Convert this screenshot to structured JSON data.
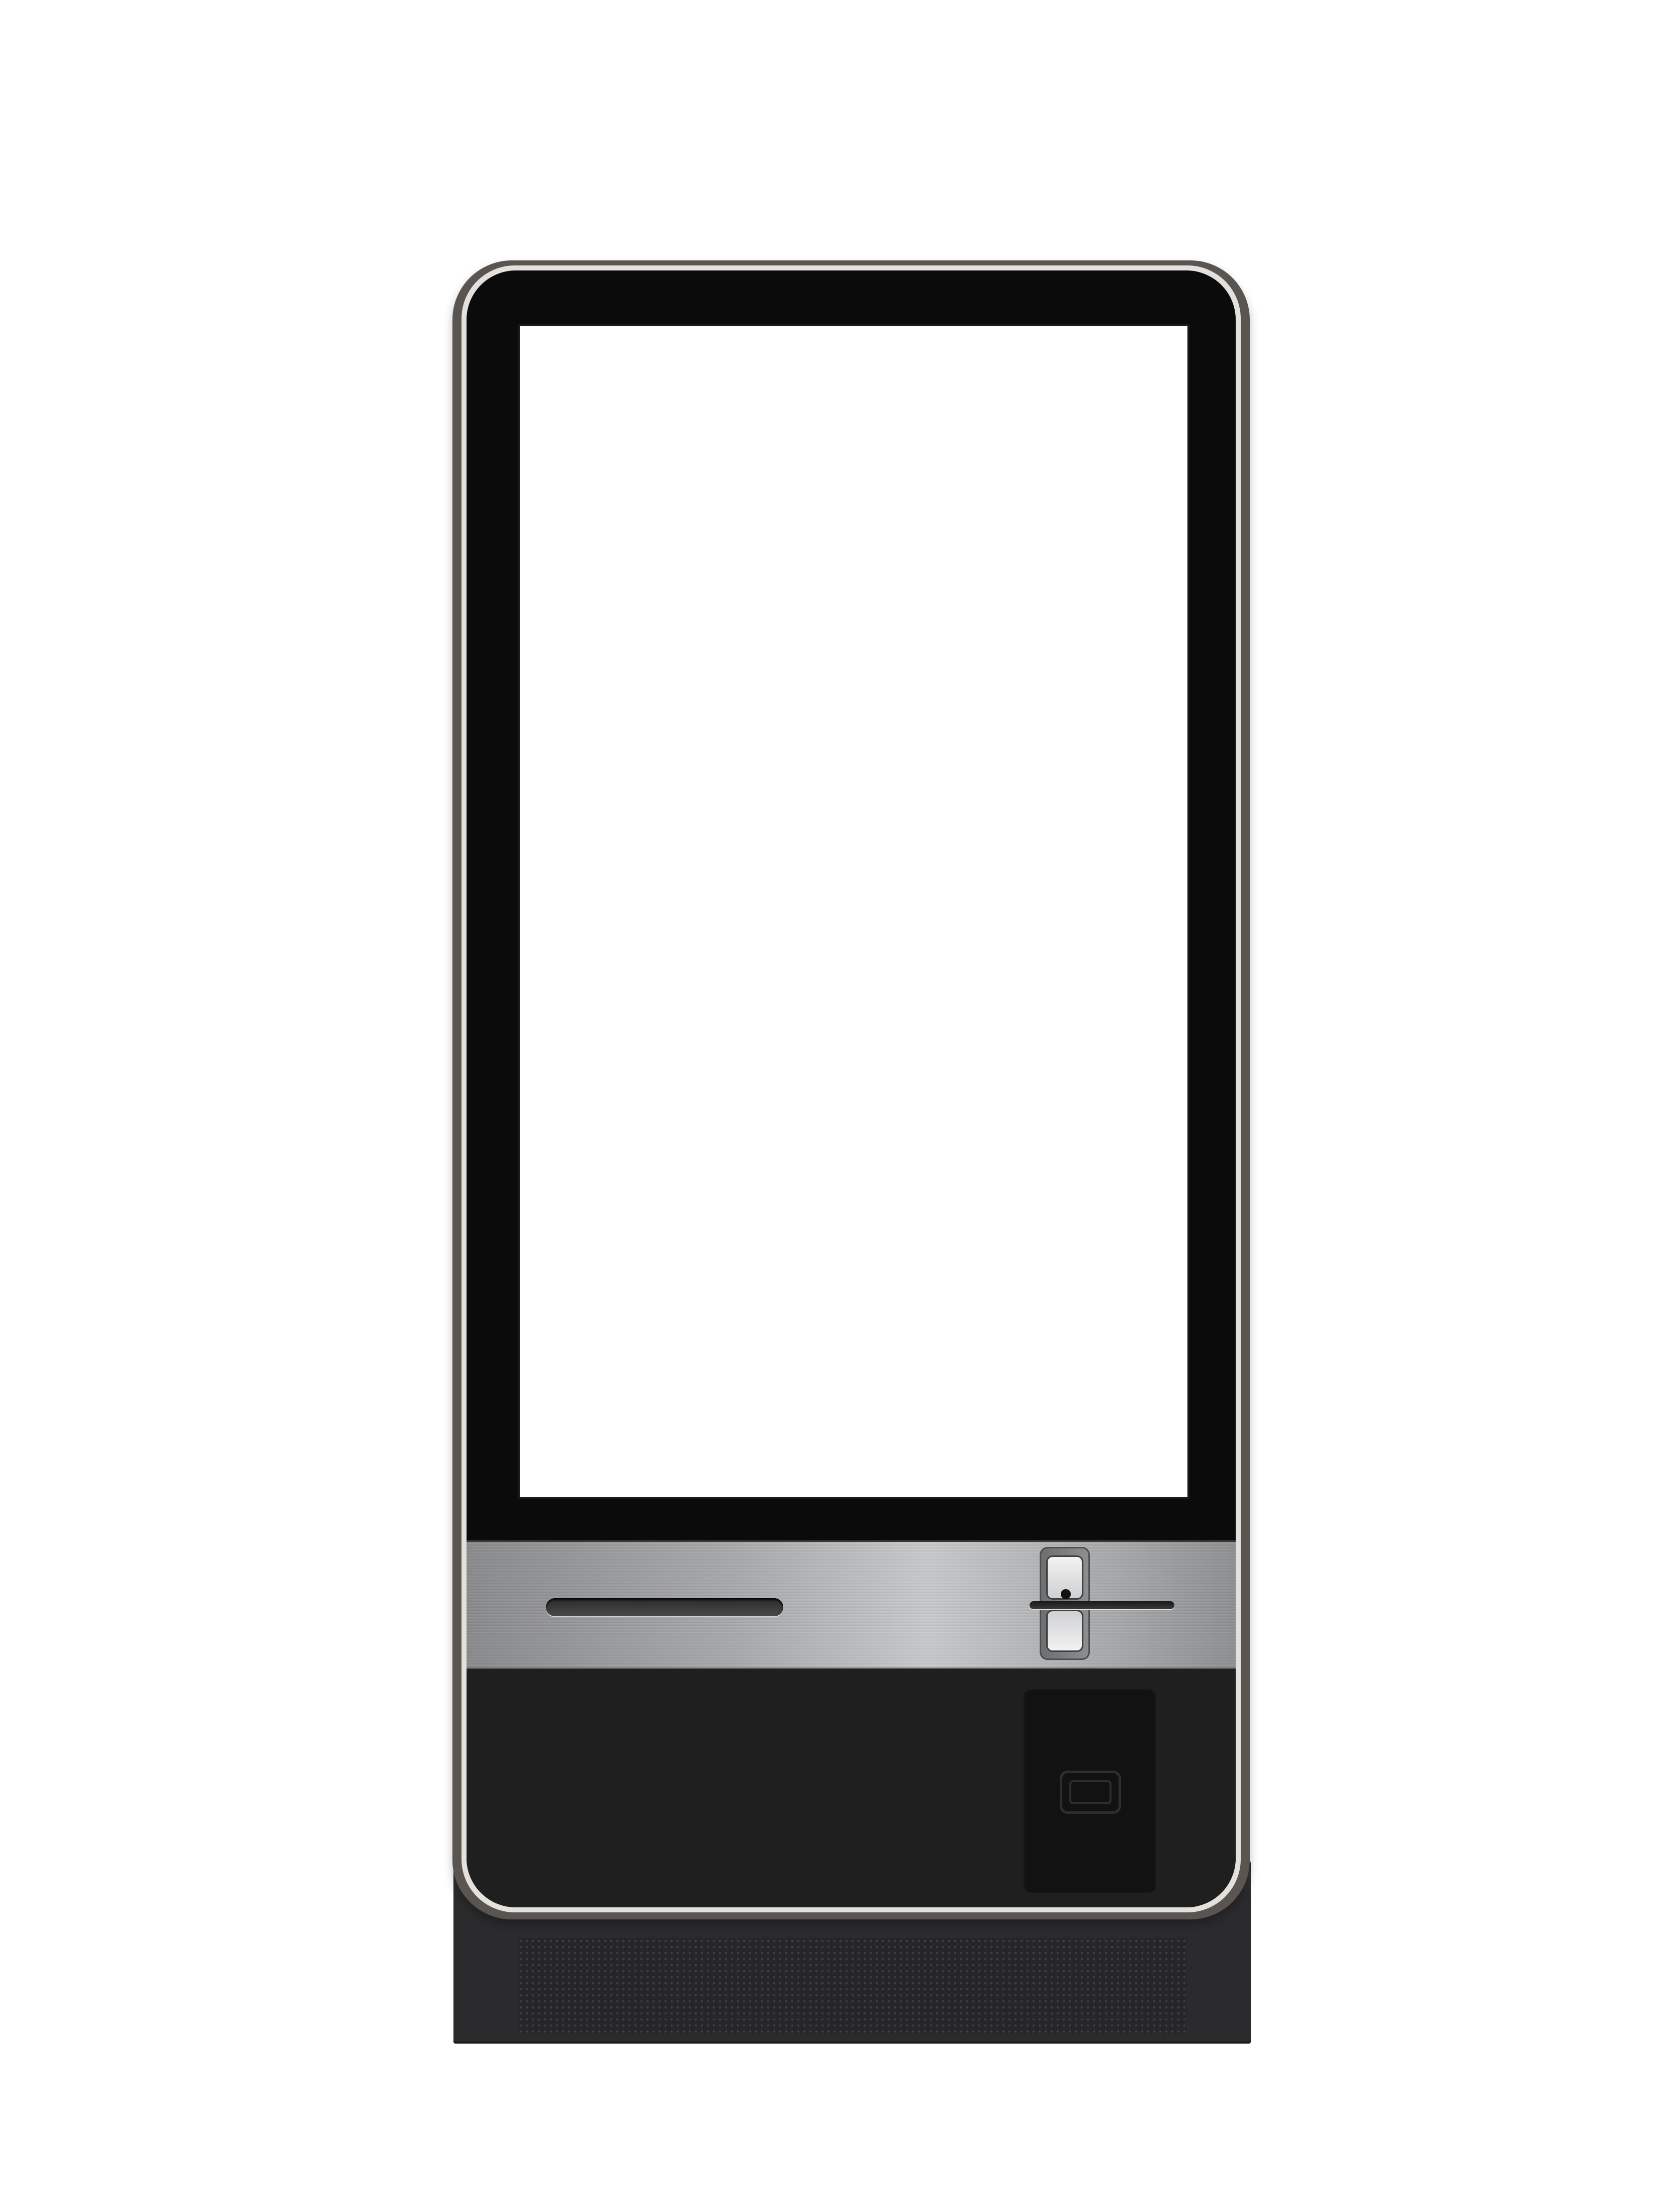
{
  "device": {
    "type": "self-service kiosk",
    "screen_color": "#ffffff",
    "bezel_color": "#0b0b0b",
    "frame_trim_color": "#e4e1dd",
    "panel_finish": "brushed steel",
    "lower_body_color": "#1f1f20",
    "base_color": "#2b2b2d",
    "components": {
      "screen": "display-screen",
      "receipt_printer": "receipt-slot",
      "card_reader": "card-reader",
      "contactless_reader": "nfc-reader-pad",
      "speaker": "speaker-grille"
    }
  }
}
